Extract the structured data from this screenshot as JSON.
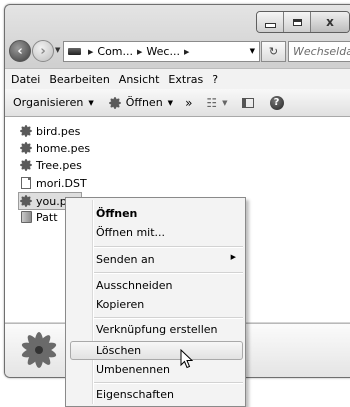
{
  "window": {
    "caption_buttons": [
      "minimize",
      "maximize",
      "close"
    ],
    "close_glyph": "x"
  },
  "nav": {
    "breadcrumbs": [
      "Com...",
      "Wec..."
    ],
    "search_placeholder": "Wechselda...",
    "refresh_glyph": "↻"
  },
  "menubar": {
    "items": [
      "Datei",
      "Bearbeiten",
      "Ansicht",
      "Extras",
      "?"
    ]
  },
  "toolbar": {
    "organize_label": "Organisieren",
    "open_label": "Öffnen",
    "overflow_label": "»",
    "help_glyph": "?"
  },
  "files": [
    {
      "name": "bird.pes",
      "icon": "flower-icon"
    },
    {
      "name": "home.pes",
      "icon": "flower-icon"
    },
    {
      "name": "Tree.pes",
      "icon": "flower-icon"
    },
    {
      "name": "mori.DST",
      "icon": "document-icon"
    },
    {
      "name": "you.pes",
      "icon": "flower-icon",
      "selected": true
    },
    {
      "name": "Patt",
      "icon": "folder-icon"
    }
  ],
  "context_menu": {
    "items": [
      {
        "label": "Öffnen",
        "bold": true
      },
      {
        "label": "Öffnen mit..."
      },
      {
        "label": "Senden an",
        "submenu": true
      },
      {
        "label": "Ausschneiden"
      },
      {
        "label": "Kopieren"
      },
      {
        "label": "Verknüpfung erstellen"
      },
      {
        "label": "Löschen",
        "highlighted": true
      },
      {
        "label": "Umbenennen"
      },
      {
        "label": "Eigenschaften"
      }
    ]
  },
  "colors": {
    "flower_icon": "#5a5a5a",
    "selection_bg": "#dedede",
    "menu_bg": "#f3f3f3"
  }
}
